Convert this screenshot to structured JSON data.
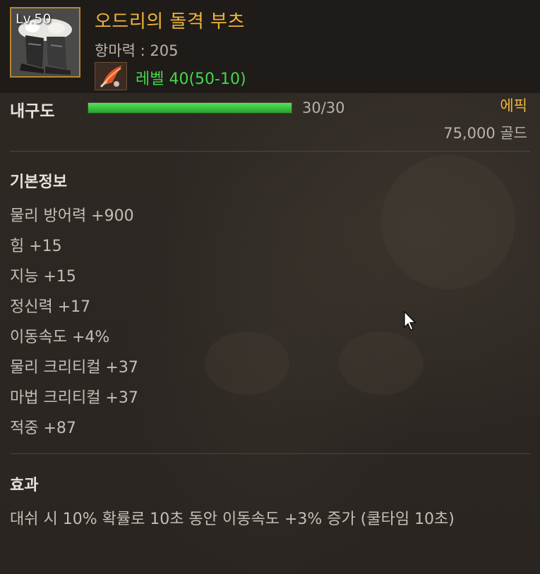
{
  "item": {
    "level_badge": "Lv.50",
    "name": "오드리의 돌격 부츠",
    "resistance": "항마력 : 205",
    "level_requirement": "레벨 40(50-10)",
    "icon": "fur-boots-icon",
    "level_icon": "feather-icon"
  },
  "durability": {
    "label": "내구도",
    "value": "30/30",
    "fraction": 1.0
  },
  "rarity": "에픽",
  "price": "75,000 골드",
  "basic_info": {
    "title": "기본정보",
    "stats": [
      "물리 방어력 +900",
      "힘 +15",
      "지능 +15",
      "정신력 +17",
      "이동속도 +4%",
      "물리 크리티컬 +37",
      "마법 크리티컬 +37",
      "적중 +87"
    ]
  },
  "effect": {
    "title": "효과",
    "text": "대쉬 시 10% 확률로 10초 동안 이동속도 +3% 증가 (쿨타임 10초)"
  },
  "colors": {
    "rarity_epic": "#f0b43a",
    "level_green": "#43d84a",
    "durability_bar": "#3fd042"
  }
}
